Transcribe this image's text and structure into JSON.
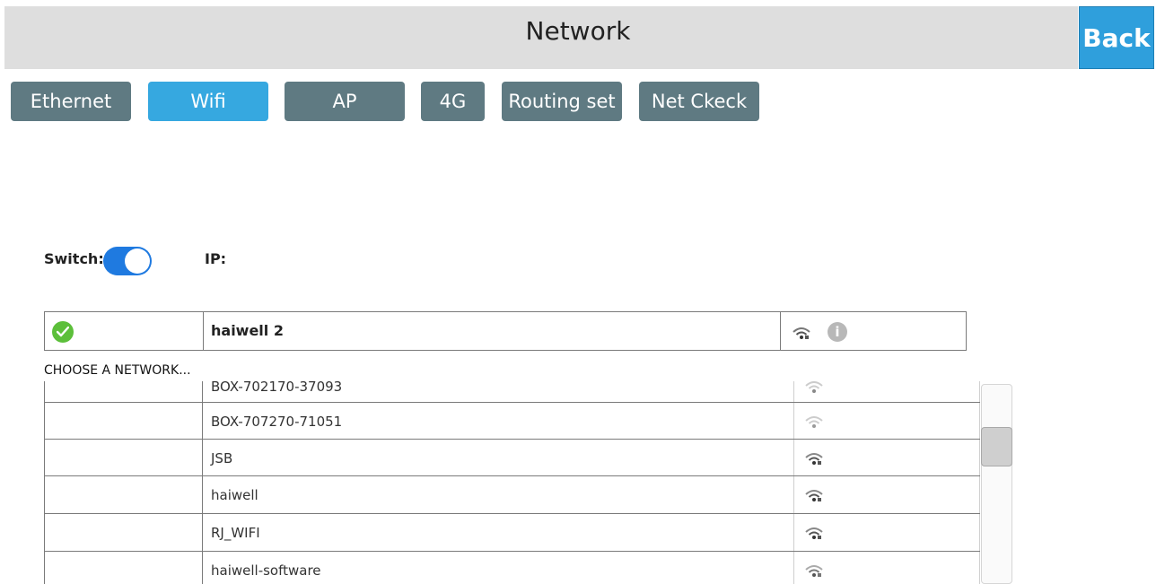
{
  "header": {
    "title": "Network",
    "back_label": "Back"
  },
  "tabs": [
    {
      "label": "Ethernet",
      "active": false
    },
    {
      "label": "Wifi",
      "active": true
    },
    {
      "label": "AP",
      "active": false
    },
    {
      "label": "4G",
      "active": false
    },
    {
      "label": "Routing set",
      "active": false
    },
    {
      "label": "Net Ckeck",
      "active": false
    }
  ],
  "wifi": {
    "switch_label": "Switch:",
    "switch_on": true,
    "ip_label": "IP:",
    "connected": {
      "name": "haiwell 2",
      "status_icon": "check-circle-icon",
      "signal_icon": "wifi-signal-icon",
      "info_icon": "info-icon",
      "info_glyph": "i"
    },
    "choose_label": "CHOOSE A NETWORK...",
    "networks": [
      {
        "name": "BOX-702170-37093",
        "signal": "wifi-weak-icon"
      },
      {
        "name": "BOX-707270-71051",
        "signal": "wifi-weak-icon"
      },
      {
        "name": "JSB",
        "signal": "wifi-signal-icon"
      },
      {
        "name": "haiwell",
        "signal": "wifi-signal-icon"
      },
      {
        "name": "RJ_WIFI",
        "signal": "wifi-signal-icon"
      },
      {
        "name": "haiwell-software",
        "signal": "wifi-signal-icon"
      }
    ]
  },
  "colors": {
    "accent": "#36a8e0",
    "tab_inactive": "#5f7a82",
    "toggle_on": "#1f7ae0",
    "connected_ok": "#5cbf3a"
  }
}
